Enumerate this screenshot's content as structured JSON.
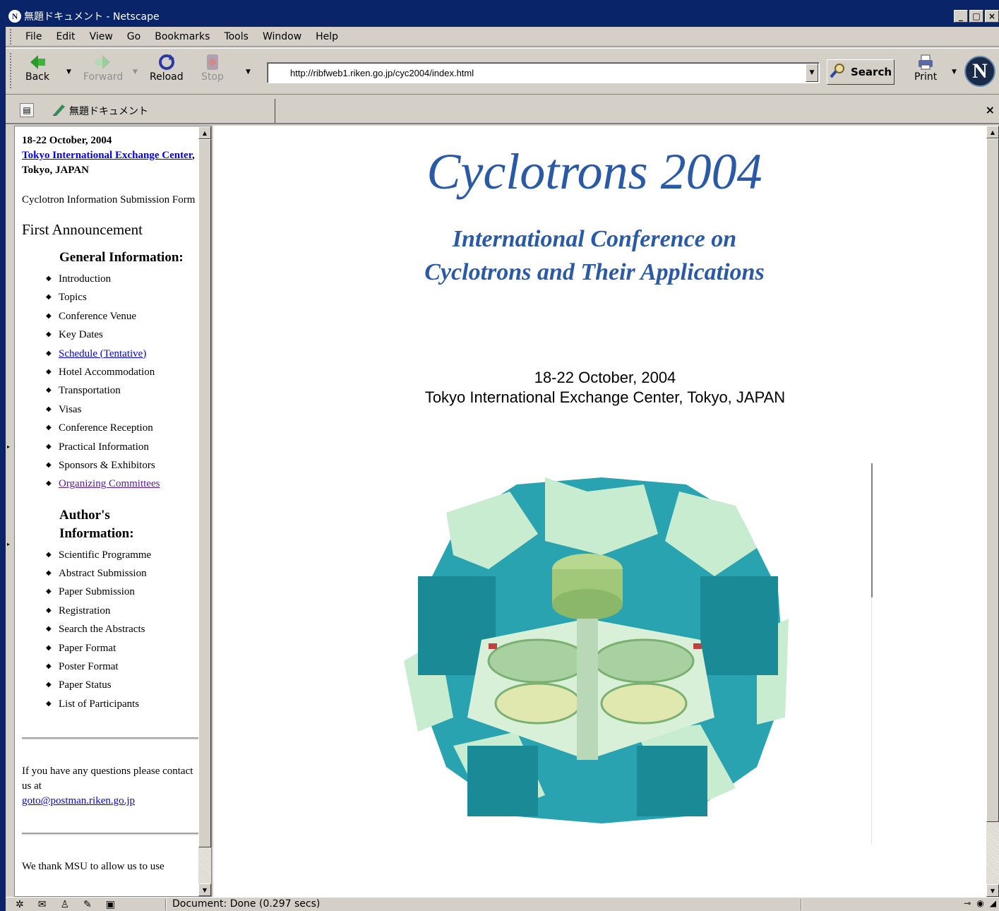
{
  "window": {
    "title": "無題ドキュメント - Netscape",
    "controls": {
      "minimize": "_",
      "maximize": "□",
      "close": "×"
    }
  },
  "menu": [
    "File",
    "Edit",
    "View",
    "Go",
    "Bookmarks",
    "Tools",
    "Window",
    "Help"
  ],
  "toolbar": {
    "back": "Back",
    "forward": "Forward",
    "reload": "Reload",
    "stop": "Stop",
    "url": "http://ribfweb1.riken.go.jp/cyc2004/index.html",
    "search": "Search",
    "print": "Print",
    "logo": "N"
  },
  "tab": {
    "title": "無題ドキュメント",
    "close": "×"
  },
  "sidebar": {
    "dates": "18-22 October, 2004",
    "venue_link": "Tokyo International Exchange Center",
    "venue_rest": ", Tokyo, JAPAN",
    "cyclotron_form": "Cyclotron Information Submission Form",
    "announcement": "First Announcement",
    "general_heading": "General Information:",
    "general_items": [
      "Introduction",
      "Topics",
      "Conference Venue",
      "Key Dates",
      "Schedule (Tentative)",
      "Hotel Accommodation",
      "Transportation",
      "Visas",
      "Conference Reception",
      "Practical Information",
      "Sponsors & Exhibitors",
      "Organizing Committees"
    ],
    "author_heading": "Author's Information:",
    "author_items": [
      "Scientific Programme",
      "Abstract Submission",
      "Paper Submission",
      "Registration",
      "Search the Abstracts",
      "Paper Format",
      "Poster Format",
      "Paper Status",
      "List of Participants"
    ],
    "contact_text": "If you have any questions please contact us at",
    "contact_email": "goto@postman.riken.go.jp",
    "thanks_text": "We thank MSU to allow us to use"
  },
  "main": {
    "title": "Cyclotrons 2004",
    "subtitle_line1": "International Conference on",
    "subtitle_line2": "Cyclotrons and Their Applications",
    "dates": "18-22 October, 2004",
    "venue": "Tokyo International Exchange Center, Tokyo, JAPAN"
  },
  "status": {
    "text": "Document: Done (0.297 secs)"
  },
  "colors": {
    "titlebar": "#0a246a",
    "chrome": "#d4d0c8",
    "heading_blue": "#2a5aa6",
    "link": "#0000ee",
    "visited": "#551a8b",
    "cyc_teal": "#2aa3b0",
    "cyc_mint": "#c8ecd0"
  }
}
